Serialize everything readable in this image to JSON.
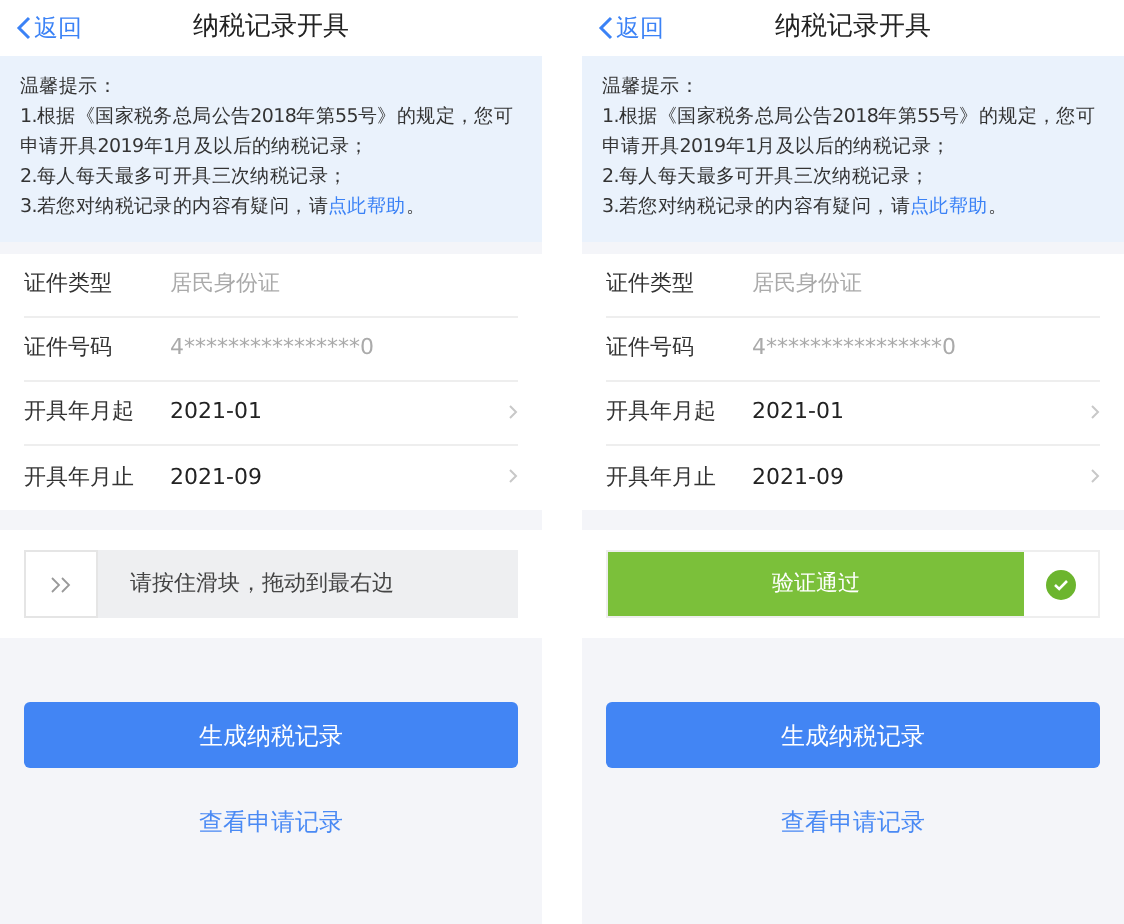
{
  "panels": [
    {
      "back": "返回",
      "title": "纳税记录开具",
      "notice": {
        "heading": "温馨提示：",
        "lines": [
          "1.根据《国家税务总局公告2018年第55号》的规定，您可申请开具2019年1月及以后的纳税记录；",
          "2.每人每天最多可开具三次纳税记录；"
        ],
        "last_line": "3.若您对纳税记录的内容有疑问，请",
        "link": "点此帮助",
        "end": "。"
      },
      "fields": [
        {
          "label": "证件类型",
          "value": "居民身份证",
          "editable": false
        },
        {
          "label": "证件号码",
          "value": "4****************0",
          "editable": false
        },
        {
          "label": "开具年月起",
          "value": "2021-01",
          "editable": true
        },
        {
          "label": "开具年月止",
          "value": "2021-09",
          "editable": true
        }
      ],
      "slider": {
        "verified": false,
        "text": "请按住滑块，拖动到最右边"
      },
      "generate_button": "生成纳税记录",
      "history_link": "查看申请记录"
    },
    {
      "back": "返回",
      "title": "纳税记录开具",
      "notice": {
        "heading": "温馨提示：",
        "lines": [
          "1.根据《国家税务总局公告2018年第55号》的规定，您可申请开具2019年1月及以后的纳税记录；",
          "2.每人每天最多可开具三次纳税记录；"
        ],
        "last_line": "3.若您对纳税记录的内容有疑问，请",
        "link": "点此帮助",
        "end": "。"
      },
      "fields": [
        {
          "label": "证件类型",
          "value": "居民身份证",
          "editable": false
        },
        {
          "label": "证件号码",
          "value": "4****************0",
          "editable": false
        },
        {
          "label": "开具年月起",
          "value": "2021-01",
          "editable": true
        },
        {
          "label": "开具年月止",
          "value": "2021-09",
          "editable": true
        }
      ],
      "slider": {
        "verified": true,
        "text": "验证通过"
      },
      "generate_button": "生成纳税记录",
      "history_link": "查看申请记录"
    }
  ]
}
